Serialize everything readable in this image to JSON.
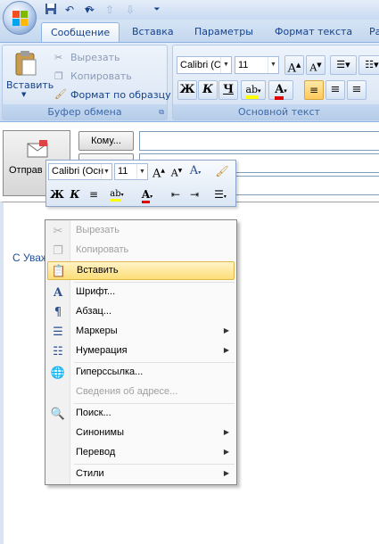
{
  "ribbon": {
    "tabs": [
      {
        "label": "Сообщение",
        "active": true
      },
      {
        "label": "Вставка",
        "active": false
      },
      {
        "label": "Параметры",
        "active": false
      },
      {
        "label": "Формат текста",
        "active": false
      },
      {
        "label": "Ра",
        "active": false
      }
    ],
    "clipboard": {
      "paste": "Вставить",
      "cut": "Вырезать",
      "copy": "Копировать",
      "format_painter": "Формат по образцу",
      "group_label": "Буфер обмена"
    },
    "basic_text": {
      "font": "Calibri (С",
      "size": "11",
      "group_label": "Основной текст"
    }
  },
  "compose": {
    "send_label": "Отправ",
    "to_button": "Кому...",
    "signature_text": "С Уваж"
  },
  "mini_toolbar": {
    "font": "Calibri (Осн",
    "size": "11"
  },
  "context_menu": {
    "items": [
      {
        "label": "Вырезать",
        "icon": "scissors-icon",
        "disabled": true
      },
      {
        "label": "Копировать",
        "icon": "copy-icon",
        "disabled": true
      },
      {
        "label": "Вставить",
        "icon": "paste-icon",
        "hot": true
      },
      {
        "label": "Шрифт...",
        "icon": "font-icon"
      },
      {
        "label": "Абзац...",
        "icon": "paragraph-icon"
      },
      {
        "label": "Маркеры",
        "icon": "bullets-icon",
        "submenu": true
      },
      {
        "label": "Нумерация",
        "icon": "numbering-icon",
        "submenu": true
      },
      {
        "label": "Гиперссылка...",
        "icon": "hyperlink-icon"
      },
      {
        "label": "Сведения об адресе...",
        "disabled": true
      },
      {
        "label": "Поиск...",
        "icon": "research-icon"
      },
      {
        "label": "Синонимы",
        "submenu": true
      },
      {
        "label": "Перевод",
        "submenu": true
      },
      {
        "label": "Стили",
        "submenu": true
      }
    ]
  },
  "colors": {
    "accent": "#15428b",
    "hot_item_top": "#fff3c6",
    "hot_item_bottom": "#fede79",
    "font_color_red": "#e00000",
    "highlight_yellow": "#ffff00"
  }
}
